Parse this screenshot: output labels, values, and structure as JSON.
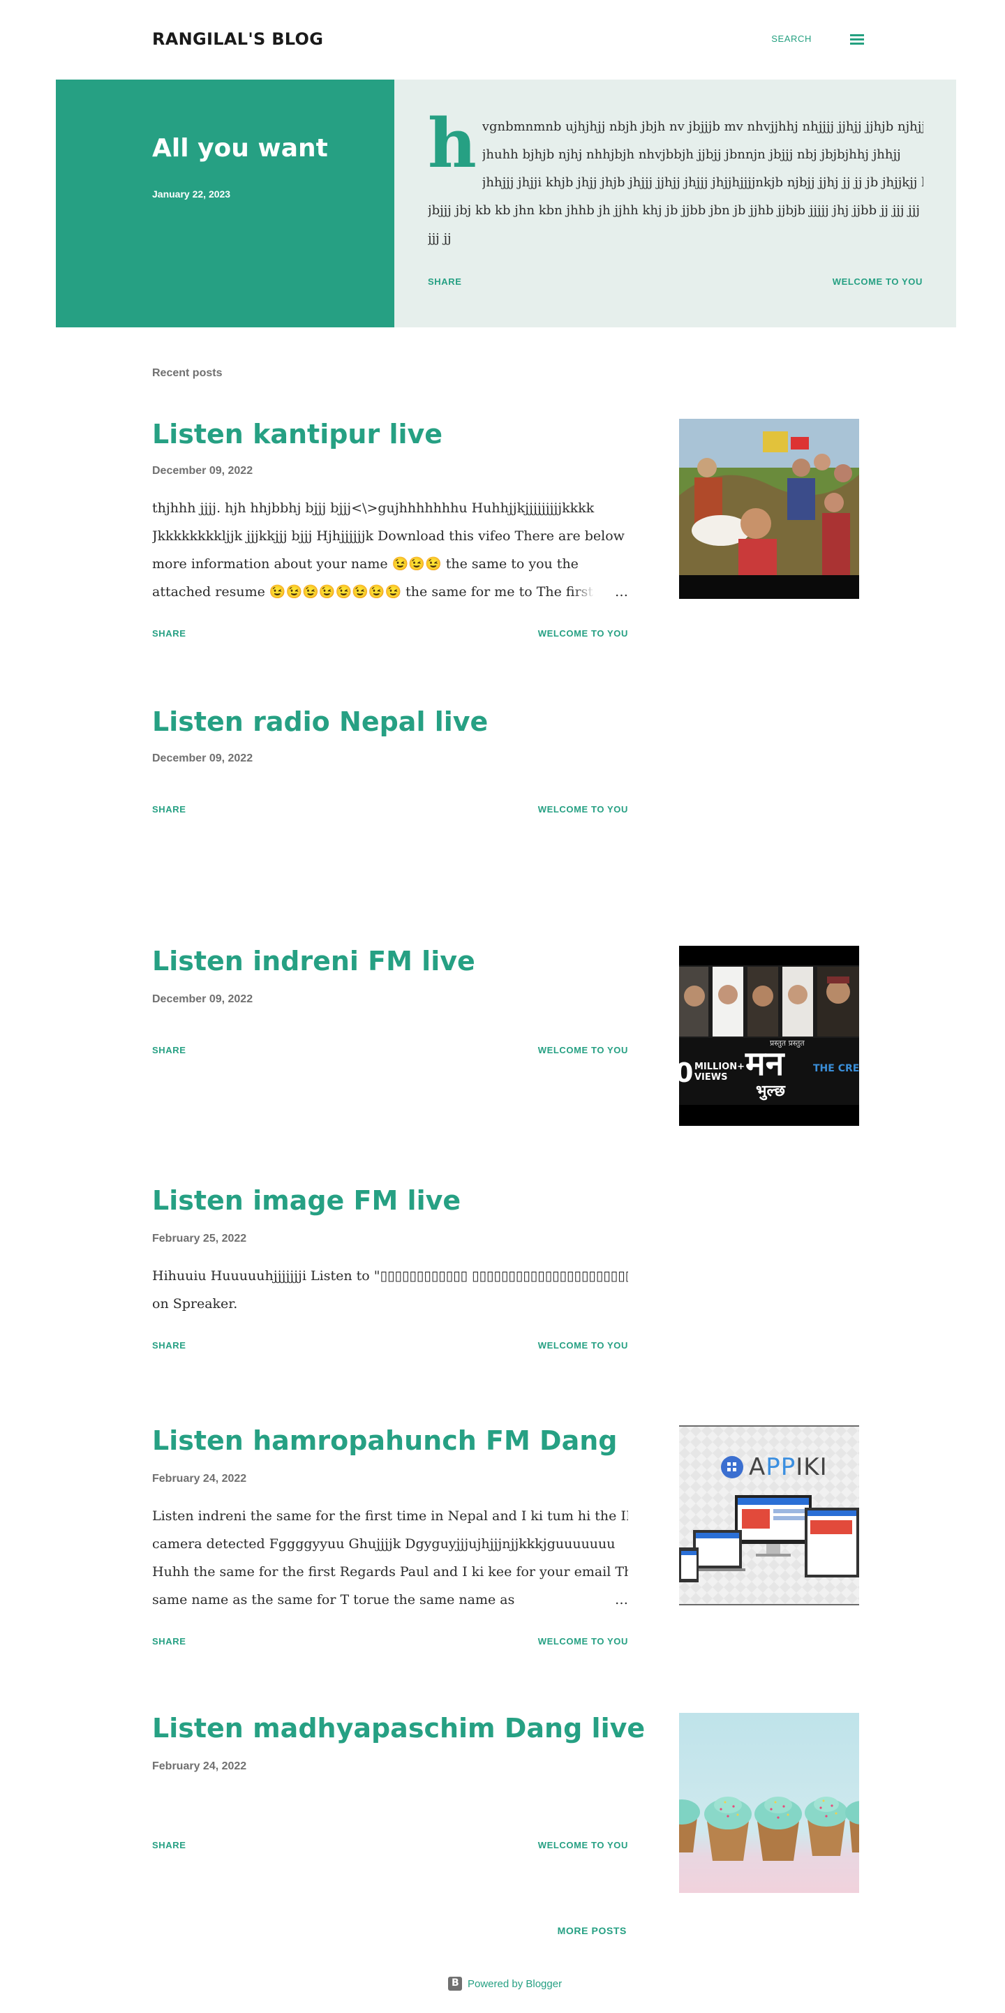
{
  "header": {
    "blog_title": "RANGILAL'S BLOG",
    "search_label": "SEARCH",
    "menu_icon": "hamburger-menu-icon"
  },
  "featured": {
    "title": "All you want",
    "date": "January 22, 2023",
    "dropcap": "h",
    "snippet_lines": [
      "vgnbmnmnb ujhjhjj nbjh jbjh nv  jbjjjb mv nhvjjhhj nhjjjj jjhjj jjhjb njhjj",
      "jhuhh bjhjb njhj nhhjbjh nhvjbbjh jjbjj jbnnjn jbjjj nbj  jbjbjhhj jhhjj",
      "jhhjjj jhjji khjb jhjj jhjb jhjjj jjhjj jhjjj jhjjhjjjjnkjb njbjj  jjhj jj jj  jb jhjjkjj khjj kb",
      "jbjjj jbj  kb kb  jhn kbn jhhb jh jjhh khj jb jjbb jbn jb jjhb jjbjb jjjjj  jhj jjbb jj jjj jjj",
      "jjj jj"
    ],
    "share_label": "SHARE",
    "jump_label": "WELCOME TO YOU"
  },
  "recent_heading": "Recent posts",
  "posts": [
    {
      "title": "Listen kantipur live",
      "date": "December 09, 2022",
      "snippet_lines": [
        "thjhhh jjjj. hjh hhjbbhj bjjj bjjj<\\>gujhhhhhhhu Huhhjjkjjjjjjjjjkkkk",
        "Jkkkkkkkkljjk jjjkkjjj bjjj Hjhjjjjjjk Download this vifeo There are below for",
        "more information about your name 😉😉😉 the same to you the",
        "attached resume 😉😉😉😉😉😉😉😉 the same for me to The first time"
      ],
      "ellipsis": "…",
      "share_label": "SHARE",
      "jump_label": "WELCOME TO YOU",
      "thumbnail": "movie-poster-thumbnail"
    },
    {
      "title": "Listen radio Nepal live",
      "date": "December 09, 2022",
      "share_label": "SHARE",
      "jump_label": "WELCOME TO YOU"
    },
    {
      "title": "Listen indreni FM live",
      "date": "December 09, 2022",
      "share_label": "SHARE",
      "jump_label": "WELCOME TO YOU",
      "thumbnail": "music-video-thumbnail",
      "thumb_text": {
        "big": "मन",
        "small": "भुल्छ",
        "views": "MILLION+ VIEWS",
        "views_num": "0",
        "creator": "THE CREATO",
        "top_caption": "प्रस्तुत प्रस्तुत"
      }
    },
    {
      "title": "Listen image FM live",
      "date": "February 25, 2022",
      "snippet_lines": [
        "Hihuuiu Huuuuuhjjjjjjji Listen to \"▯▯▯▯▯▯▯▯▯▯▯▯ ▯▯▯▯▯▯▯▯▯▯▯▯▯▯▯▯▯▯▯▯▯▯▯▯\"",
        "on Spreaker."
      ],
      "share_label": "SHARE",
      "jump_label": "WELCOME TO YOU"
    },
    {
      "title": "Listen hamropahunch FM Dang",
      "date": "February 24, 2022",
      "snippet_lines": [
        " Listen indreni the same for the first time in Nepal and I ki tum hi the IP",
        "camera detected  Fggggyyuu Ghujjjjk Dgyguyjjjujhjjjnjjkkkjguuuuuuu",
        "Huhh the same for the first Regards Paul and I ki kee for your email The",
        "same name as the same for T torue the same name as"
      ],
      "ellipsis": "…",
      "share_label": "SHARE",
      "jump_label": "WELCOME TO YOU",
      "thumbnail": "appiki-devices-thumbnail",
      "thumb_logo": {
        "a1": "A",
        "pp": "PP",
        "iki": "IKI"
      }
    },
    {
      "title": "Listen madhyapaschim Dang live",
      "date": "February 24, 2022",
      "share_label": "SHARE",
      "jump_label": "WELCOME TO YOU",
      "thumbnail": "cupcakes-thumbnail"
    }
  ],
  "more_posts_label": "MORE POSTS",
  "footer": {
    "powered_by": "Powered by Blogger",
    "icon": "blogger-logo-icon"
  },
  "colors": {
    "accent": "#26a083",
    "hero_bg": "#e6efec",
    "meta_text": "#707070"
  }
}
